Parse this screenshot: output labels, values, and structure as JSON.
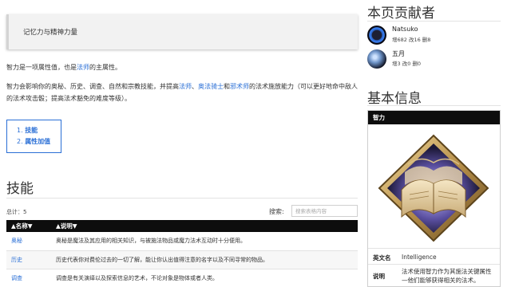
{
  "quote": "记忆力与精神力量",
  "intro": {
    "p1_pre": "智力是一项属性值，也是",
    "p1_link": "法师",
    "p1_post": "的主属性。",
    "p2_a": "智力会影响你的奥秘、历史、调查、自然和宗教技能，并提高",
    "p2_link1": "法师",
    "p2_sep": "、",
    "p2_link2": "奥法骑士",
    "p2_and": "和",
    "p2_link3": "邪术师",
    "p2_b": "的法术施放能力（可以更好地命中敌人的法术攻击骰；提高法术豁免的难度等级）。"
  },
  "toc": {
    "items": [
      {
        "num": "1.",
        "label": "技能"
      },
      {
        "num": "2.",
        "label": "属性加值"
      }
    ]
  },
  "skills_section": {
    "heading": "技能",
    "total": "总计：5",
    "search_label": "搜索:",
    "search_placeholder": "搜索表格内容",
    "columns": [
      "▲名称▼",
      "▲说明▼"
    ],
    "rows": [
      {
        "name": "奥秘",
        "desc": "奥秘是魔法及其应用的相关知识，与被施法物品或魔力法术互动时十分便用。"
      },
      {
        "name": "历史",
        "desc": "历史代表你对费伦过去的一切了解，能让你认出值得注意的名字以及不同寻常的物品。"
      },
      {
        "name": "调查",
        "desc": "调查是有关演绎以及探索信息的艺术，不论对象是物体或者人类。"
      }
    ]
  },
  "sidebar": {
    "contributors_heading": "本页贡献者",
    "contributors": [
      {
        "name": "Natsuko",
        "stats": "增682 改16 删8"
      },
      {
        "name": "五月",
        "stats": "增3 改0 删0"
      }
    ],
    "info_heading": "基本信息",
    "infobox": {
      "title": "智力",
      "rows": [
        {
          "key": "英文名",
          "value": "Intelligence"
        },
        {
          "key": "说明",
          "value": "法术使用智力作为其施法关键属性—他们能够获得相关的法术。"
        }
      ]
    }
  },
  "colors": {
    "link": "#2a6fd6",
    "header_bg": "#0d0d0d"
  }
}
